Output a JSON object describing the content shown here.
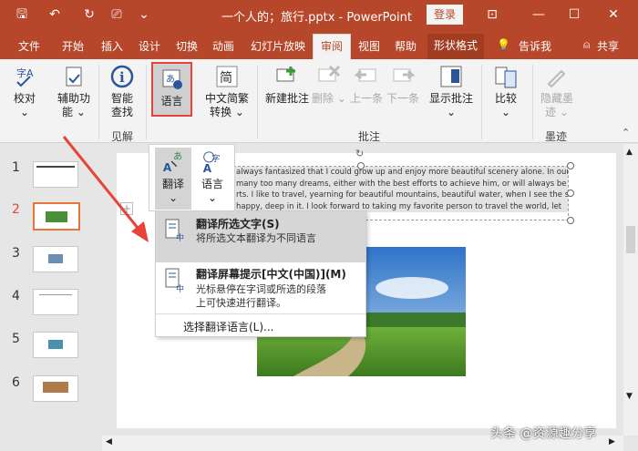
{
  "window": {
    "title": "一个人的；旅行.pptx  -  PowerPoint",
    "login": "登录",
    "share": "共享"
  },
  "tabs": {
    "file": "文件",
    "home": "开始",
    "insert": "插入",
    "design": "设计",
    "transitions": "切换",
    "animations": "动画",
    "slideshow": "幻灯片放映",
    "review": "审阅",
    "view": "视图",
    "help": "帮助",
    "shape_format": "形状格式",
    "tell_me": "告诉我"
  },
  "ribbon": {
    "spelling": "校对",
    "accessibility": "辅助功",
    "accessibility2": "能",
    "smart_lookup": "智能",
    "smart_lookup2": "查找",
    "language": "语言",
    "chs_cht": "中文简繁",
    "chs_cht2": "转换",
    "new_comment": "新建批注",
    "delete": "删除",
    "previous": "上一条",
    "next": "下一条",
    "show_comments": "显示批注",
    "compare": "比较",
    "hide_ink": "隐藏墨",
    "hide_ink2": "迹",
    "group_insights": "见解",
    "group_comments": "批注",
    "group_ink": "墨迹"
  },
  "language_dropdown": {
    "translate": "翻译",
    "language": "语言"
  },
  "translate_menu": {
    "item1_title": "翻译所选文字(S)",
    "item1_desc": "将所选文本翻译为不同语言",
    "item2_title": "翻译屏幕提示[中文(中国)](M)",
    "item2_desc1": "光标悬停在字词或所选的段落",
    "item2_desc2": "上可快速进行翻译。",
    "item3": "选择翻译语言(L)..."
  },
  "slides": {
    "numbers": [
      "1",
      "2",
      "3",
      "4",
      "5",
      "6"
    ],
    "selected": "2"
  },
  "slide_text": [
    "always fantasized that I could grow up and enjoy more beautiful scenery alone. In our",
    "many too many dreams, either with the best efforts to achieve him, or will always be",
    "rts. I like to travel, yearning for beautiful mountains, beautiful water, when I see the sea",
    "happy, deep in it. I look forward to taking my favorite person to travel the world, let"
  ],
  "watermark": "头条 @资源趣分享",
  "colors": {
    "accent": "#b7472a",
    "highlight": "#e3e3e3",
    "arrow": "#e8433a"
  }
}
